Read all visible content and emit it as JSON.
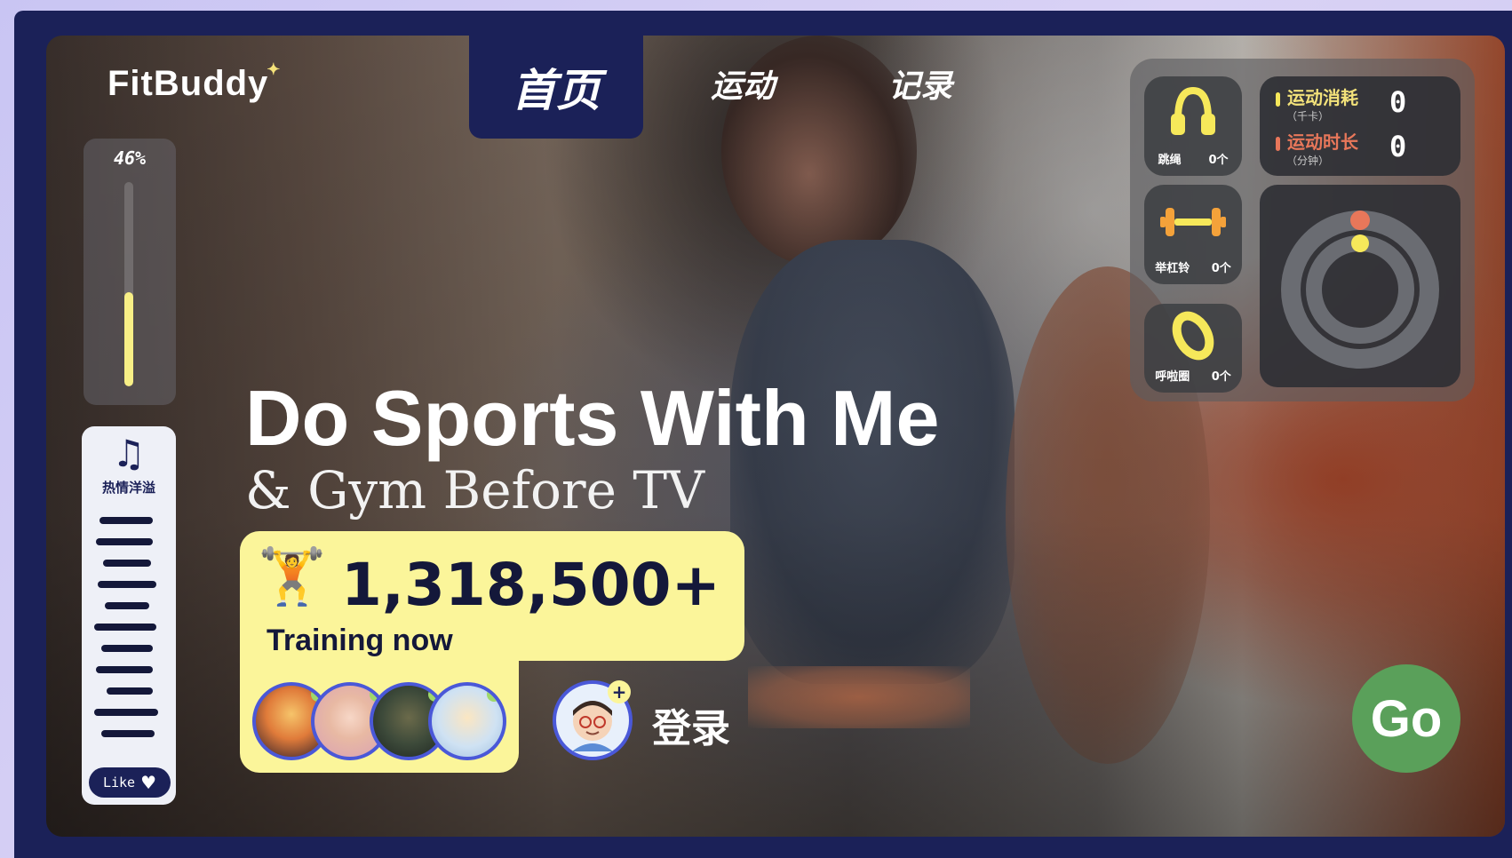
{
  "app": {
    "logo": "FitBuddy",
    "logo_spark": "✦"
  },
  "nav": {
    "home": "首页",
    "sport": "运动",
    "record": "记录"
  },
  "volume": {
    "percent_label": "46%",
    "level": 0.46
  },
  "music": {
    "icon": "music-note-icon",
    "label": "热情洋溢",
    "like_label": "Like"
  },
  "hero": {
    "title": "Do Sports With Me",
    "subtitle": "& Gym Before TV"
  },
  "training": {
    "count": "1,318,500+",
    "label": "Training now"
  },
  "login": {
    "label": "登录"
  },
  "equipment": [
    {
      "name": "跳绳",
      "count": "0个",
      "icon": "jump-rope-icon"
    },
    {
      "name": "举杠铃",
      "count": "0个",
      "icon": "barbell-icon"
    },
    {
      "name": "呼啦圈",
      "count": "0个",
      "icon": "hula-hoop-icon"
    }
  ],
  "stats": {
    "calories_label": "运动消耗",
    "calories_unit": "（千卡）",
    "calories_value": "0",
    "duration_label": "运动时长",
    "duration_unit": "（分钟）",
    "duration_value": "0"
  },
  "go": {
    "label": "Go"
  },
  "colors": {
    "navy": "#1b2158",
    "yellow": "#fbf59a",
    "green": "#5aa05a",
    "orange": "#e8775a"
  }
}
